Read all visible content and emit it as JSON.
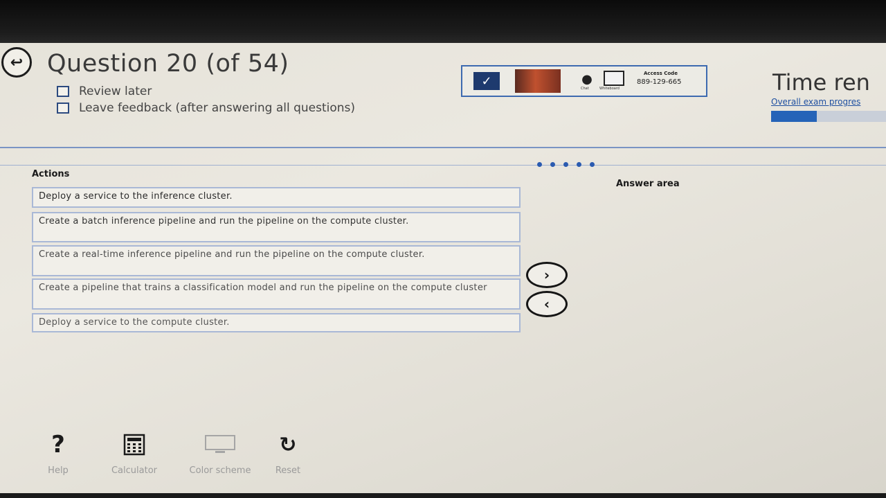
{
  "header": {
    "question_title": "Question 20 (of 54)",
    "review_later_label": "Review later",
    "leave_feedback_label": "Leave feedback (after answering all questions)"
  },
  "proctor_bar": {
    "chat_label": "Chat",
    "whiteboard_label": "Whiteboard",
    "access_code_label": "Access Code",
    "access_code": "889-129-665"
  },
  "timer": {
    "title": "Time ren",
    "progress_label": "Overall exam progres",
    "progress_fraction": 0.4
  },
  "actions": {
    "header": "Actions",
    "items": [
      {
        "text": "Deploy a service to the inference cluster."
      },
      {
        "text": "Create a batch inference pipeline and run the pipeline on the compute cluster."
      },
      {
        "text": "Create a real-time inference pipeline and run the pipeline on the compute cluster."
      },
      {
        "text": "Create a pipeline that trains a classification model and run the pipeline on the compute cluster"
      },
      {
        "text": "Deploy a service to the compute cluster."
      }
    ]
  },
  "answer": {
    "header": "Answer area",
    "items": []
  },
  "controls": {
    "move_right_icon": "chevron-right-icon",
    "move_left_icon": "chevron-left-icon"
  },
  "toolbar": {
    "help_label": "Help",
    "calculator_label": "Calculator",
    "color_scheme_label": "Color scheme",
    "reset_label": "Reset"
  },
  "colors": {
    "accent": "#2563b8",
    "item_border": "#a9b8d6",
    "badge": "#1e3a6e"
  }
}
